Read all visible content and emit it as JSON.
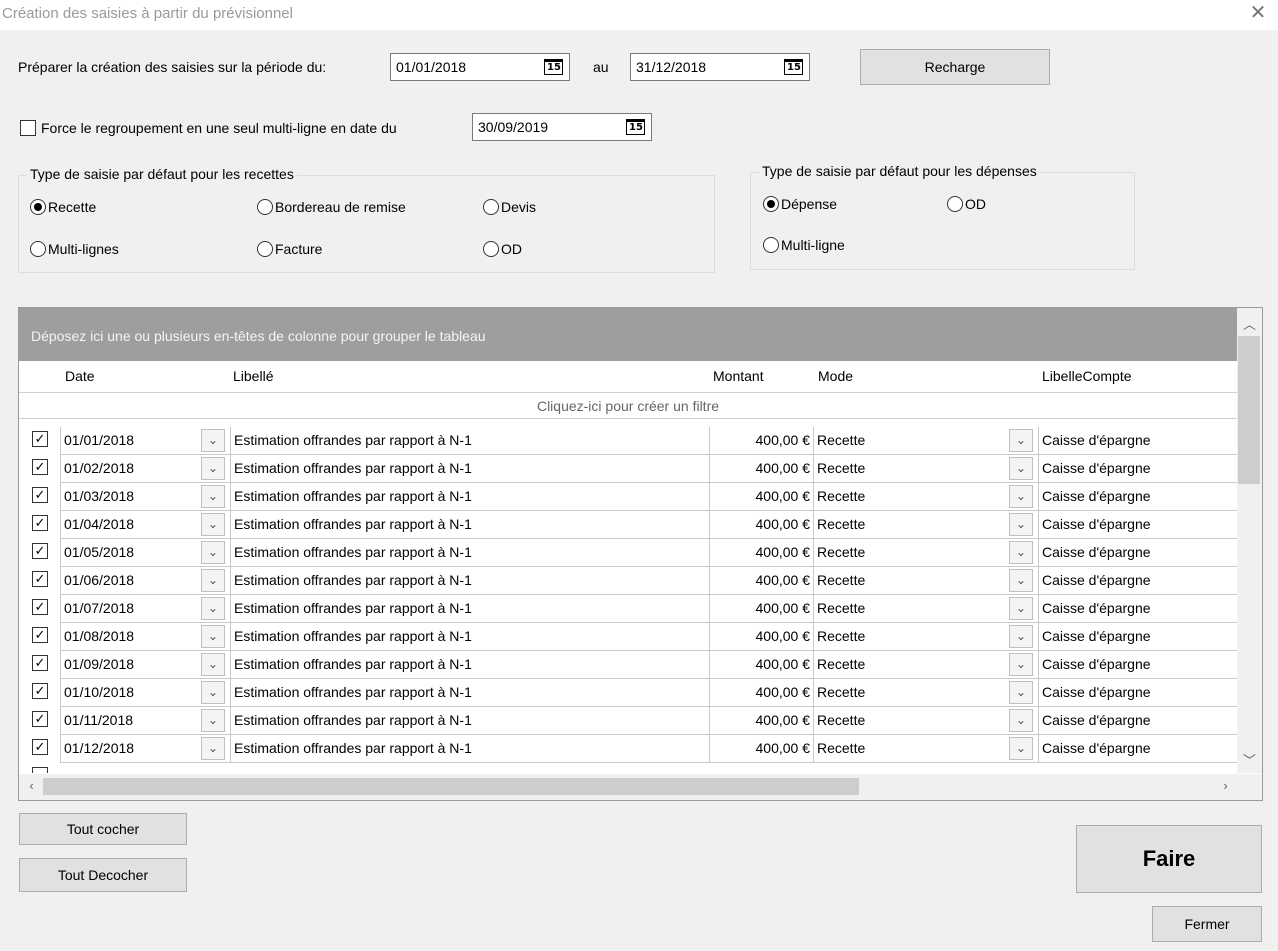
{
  "window": {
    "title": "Création des saisies à partir du prévisionnel"
  },
  "period": {
    "label": "Préparer la création des saisies sur la période du:",
    "from": "01/01/2018",
    "sep": "au",
    "to": "31/12/2018",
    "reload_label": "Recharge",
    "calendar_glyph": "15"
  },
  "force": {
    "checked": false,
    "label": "Force le regroupement en une seul multi-ligne en date du",
    "date": "30/09/2019"
  },
  "recettes": {
    "title": "Type de saisie par défaut pour les recettes",
    "options": [
      {
        "label": "Recette",
        "selected": true
      },
      {
        "label": "Bordereau de remise",
        "selected": false
      },
      {
        "label": "Devis",
        "selected": false
      },
      {
        "label": "Multi-lignes",
        "selected": false
      },
      {
        "label": "Facture",
        "selected": false
      },
      {
        "label": "OD",
        "selected": false
      }
    ]
  },
  "depenses": {
    "title": "Type de saisie par défaut pour les dépenses",
    "options": [
      {
        "label": "Dépense",
        "selected": true
      },
      {
        "label": "OD",
        "selected": false
      },
      {
        "label": "Multi-ligne",
        "selected": false
      }
    ]
  },
  "grid": {
    "group_hint": "Déposez ici une ou plusieurs en-têtes de colonne pour grouper le tableau",
    "columns": [
      "Date",
      "Libellé",
      "Montant",
      "Mode",
      "LibelleCompte"
    ],
    "filter_hint": "Cliquez-ici pour créer un filtre",
    "rows": [
      {
        "checked": true,
        "date": "01/01/2018",
        "libelle": "Estimation offrandes  par rapport à N-1",
        "montant": "400,00 €",
        "mode": "Recette",
        "compte": "Caisse d'épargne"
      },
      {
        "checked": true,
        "date": "01/02/2018",
        "libelle": "Estimation offrandes  par rapport à N-1",
        "montant": "400,00 €",
        "mode": "Recette",
        "compte": "Caisse d'épargne"
      },
      {
        "checked": true,
        "date": "01/03/2018",
        "libelle": "Estimation offrandes  par rapport à N-1",
        "montant": "400,00 €",
        "mode": "Recette",
        "compte": "Caisse d'épargne"
      },
      {
        "checked": true,
        "date": "01/04/2018",
        "libelle": "Estimation offrandes  par rapport à N-1",
        "montant": "400,00 €",
        "mode": "Recette",
        "compte": "Caisse d'épargne"
      },
      {
        "checked": true,
        "date": "01/05/2018",
        "libelle": "Estimation offrandes  par rapport à N-1",
        "montant": "400,00 €",
        "mode": "Recette",
        "compte": "Caisse d'épargne"
      },
      {
        "checked": true,
        "date": "01/06/2018",
        "libelle": "Estimation offrandes  par rapport à N-1",
        "montant": "400,00 €",
        "mode": "Recette",
        "compte": "Caisse d'épargne"
      },
      {
        "checked": true,
        "date": "01/07/2018",
        "libelle": "Estimation offrandes  par rapport à N-1",
        "montant": "400,00 €",
        "mode": "Recette",
        "compte": "Caisse d'épargne"
      },
      {
        "checked": true,
        "date": "01/08/2018",
        "libelle": "Estimation offrandes  par rapport à N-1",
        "montant": "400,00 €",
        "mode": "Recette",
        "compte": "Caisse d'épargne"
      },
      {
        "checked": true,
        "date": "01/09/2018",
        "libelle": "Estimation offrandes  par rapport à N-1",
        "montant": "400,00 €",
        "mode": "Recette",
        "compte": "Caisse d'épargne"
      },
      {
        "checked": true,
        "date": "01/10/2018",
        "libelle": "Estimation offrandes  par rapport à N-1",
        "montant": "400,00 €",
        "mode": "Recette",
        "compte": "Caisse d'épargne"
      },
      {
        "checked": true,
        "date": "01/11/2018",
        "libelle": "Estimation offrandes  par rapport à N-1",
        "montant": "400,00 €",
        "mode": "Recette",
        "compte": "Caisse d'épargne"
      },
      {
        "checked": true,
        "date": "01/12/2018",
        "libelle": "Estimation offrandes  par rapport à N-1",
        "montant": "400,00 €",
        "mode": "Recette",
        "compte": "Caisse d'épargne"
      }
    ]
  },
  "buttons": {
    "check_all": "Tout cocher",
    "uncheck_all": "Tout Decocher",
    "do": "Faire",
    "close": "Fermer"
  }
}
